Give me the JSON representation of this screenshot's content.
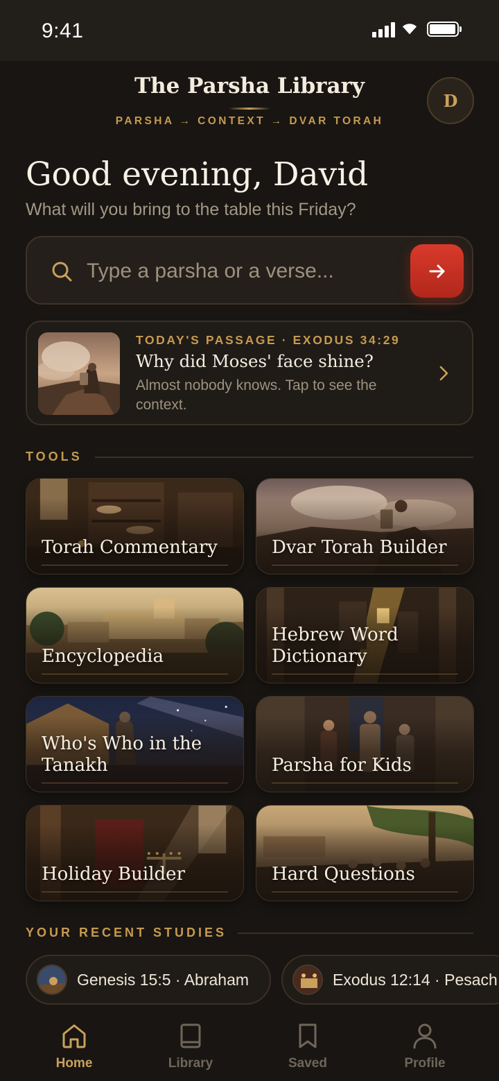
{
  "status_bar": {
    "time": "9:41"
  },
  "header": {
    "title": "The Parsha Library",
    "flow": "PARSHA → CONTEXT → DVAR TORAH",
    "avatar_initial": "D"
  },
  "greeting": {
    "title": "Good evening, David",
    "subtitle": "What will you bring to the table this Friday?"
  },
  "search": {
    "placeholder": "Type a parsha or a verse...",
    "value": ""
  },
  "passage": {
    "kicker": "TODAY'S PASSAGE · EXODUS 34:29",
    "title": "Why did Moses' face shine?",
    "description": "Almost nobody knows. Tap to see the context."
  },
  "tools": {
    "section_label": "TOOLS",
    "items": [
      {
        "label": "Torah Commentary"
      },
      {
        "label": "Dvar Torah Builder"
      },
      {
        "label": "Encyclopedia"
      },
      {
        "label": "Hebrew Word Dictionary"
      },
      {
        "label": "Who's Who in the Tanakh"
      },
      {
        "label": "Parsha for Kids"
      },
      {
        "label": "Holiday Builder"
      },
      {
        "label": "Hard Questions"
      }
    ]
  },
  "recent": {
    "section_label": "YOUR RECENT STUDIES",
    "items": [
      {
        "label": "Genesis 15:5 · Abraham"
      },
      {
        "label": "Exodus 12:14 · Pesach"
      }
    ]
  },
  "nav": {
    "items": [
      {
        "label": "Home",
        "icon": "home-icon",
        "active": true
      },
      {
        "label": "Library",
        "icon": "book-icon",
        "active": false
      },
      {
        "label": "Saved",
        "icon": "bookmark-icon",
        "active": false
      },
      {
        "label": "Profile",
        "icon": "user-icon",
        "active": false
      }
    ]
  },
  "colors": {
    "background": "#181512",
    "accent_gold": "#c9a15c",
    "accent_red": "#c8301f"
  }
}
